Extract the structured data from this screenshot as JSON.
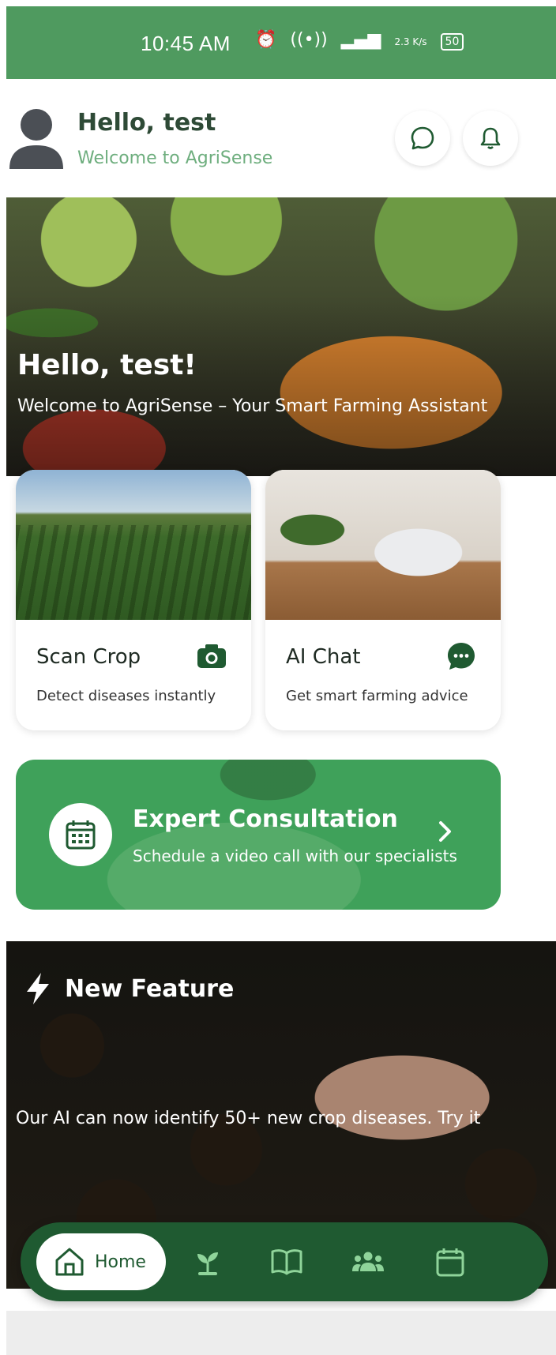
{
  "status_bar": {
    "time": "10:45 AM",
    "network_speed": "2.3 K/s",
    "battery": "50"
  },
  "header": {
    "greeting": "Hello, test",
    "subtitle": "Welcome to AgriSense"
  },
  "hero": {
    "title": "Hello, test!",
    "subtitle": "Welcome to AgriSense – Your Smart Farming Assistant"
  },
  "cards": [
    {
      "title": "Scan Crop",
      "description": "Detect diseases instantly",
      "icon": "camera-icon"
    },
    {
      "title": "AI Chat",
      "description": "Get smart farming advice",
      "icon": "chat-bubble-icon"
    }
  ],
  "consultation": {
    "title": "Expert Consultation",
    "subtitle": "Schedule a video call with our specialists"
  },
  "feature": {
    "title": "New Feature",
    "text": "Our AI can now identify 50+ new crop diseases. Try it"
  },
  "bottom_nav": {
    "home_label": "Home",
    "items": [
      "home-icon",
      "sprout-icon",
      "book-icon",
      "community-icon",
      "calendar-icon"
    ]
  },
  "colors": {
    "status_bar": "#4f9a5f",
    "primary_dark": "#1f5a31",
    "accent_green": "#3fa15a",
    "subtitle_green": "#6eae7e"
  }
}
